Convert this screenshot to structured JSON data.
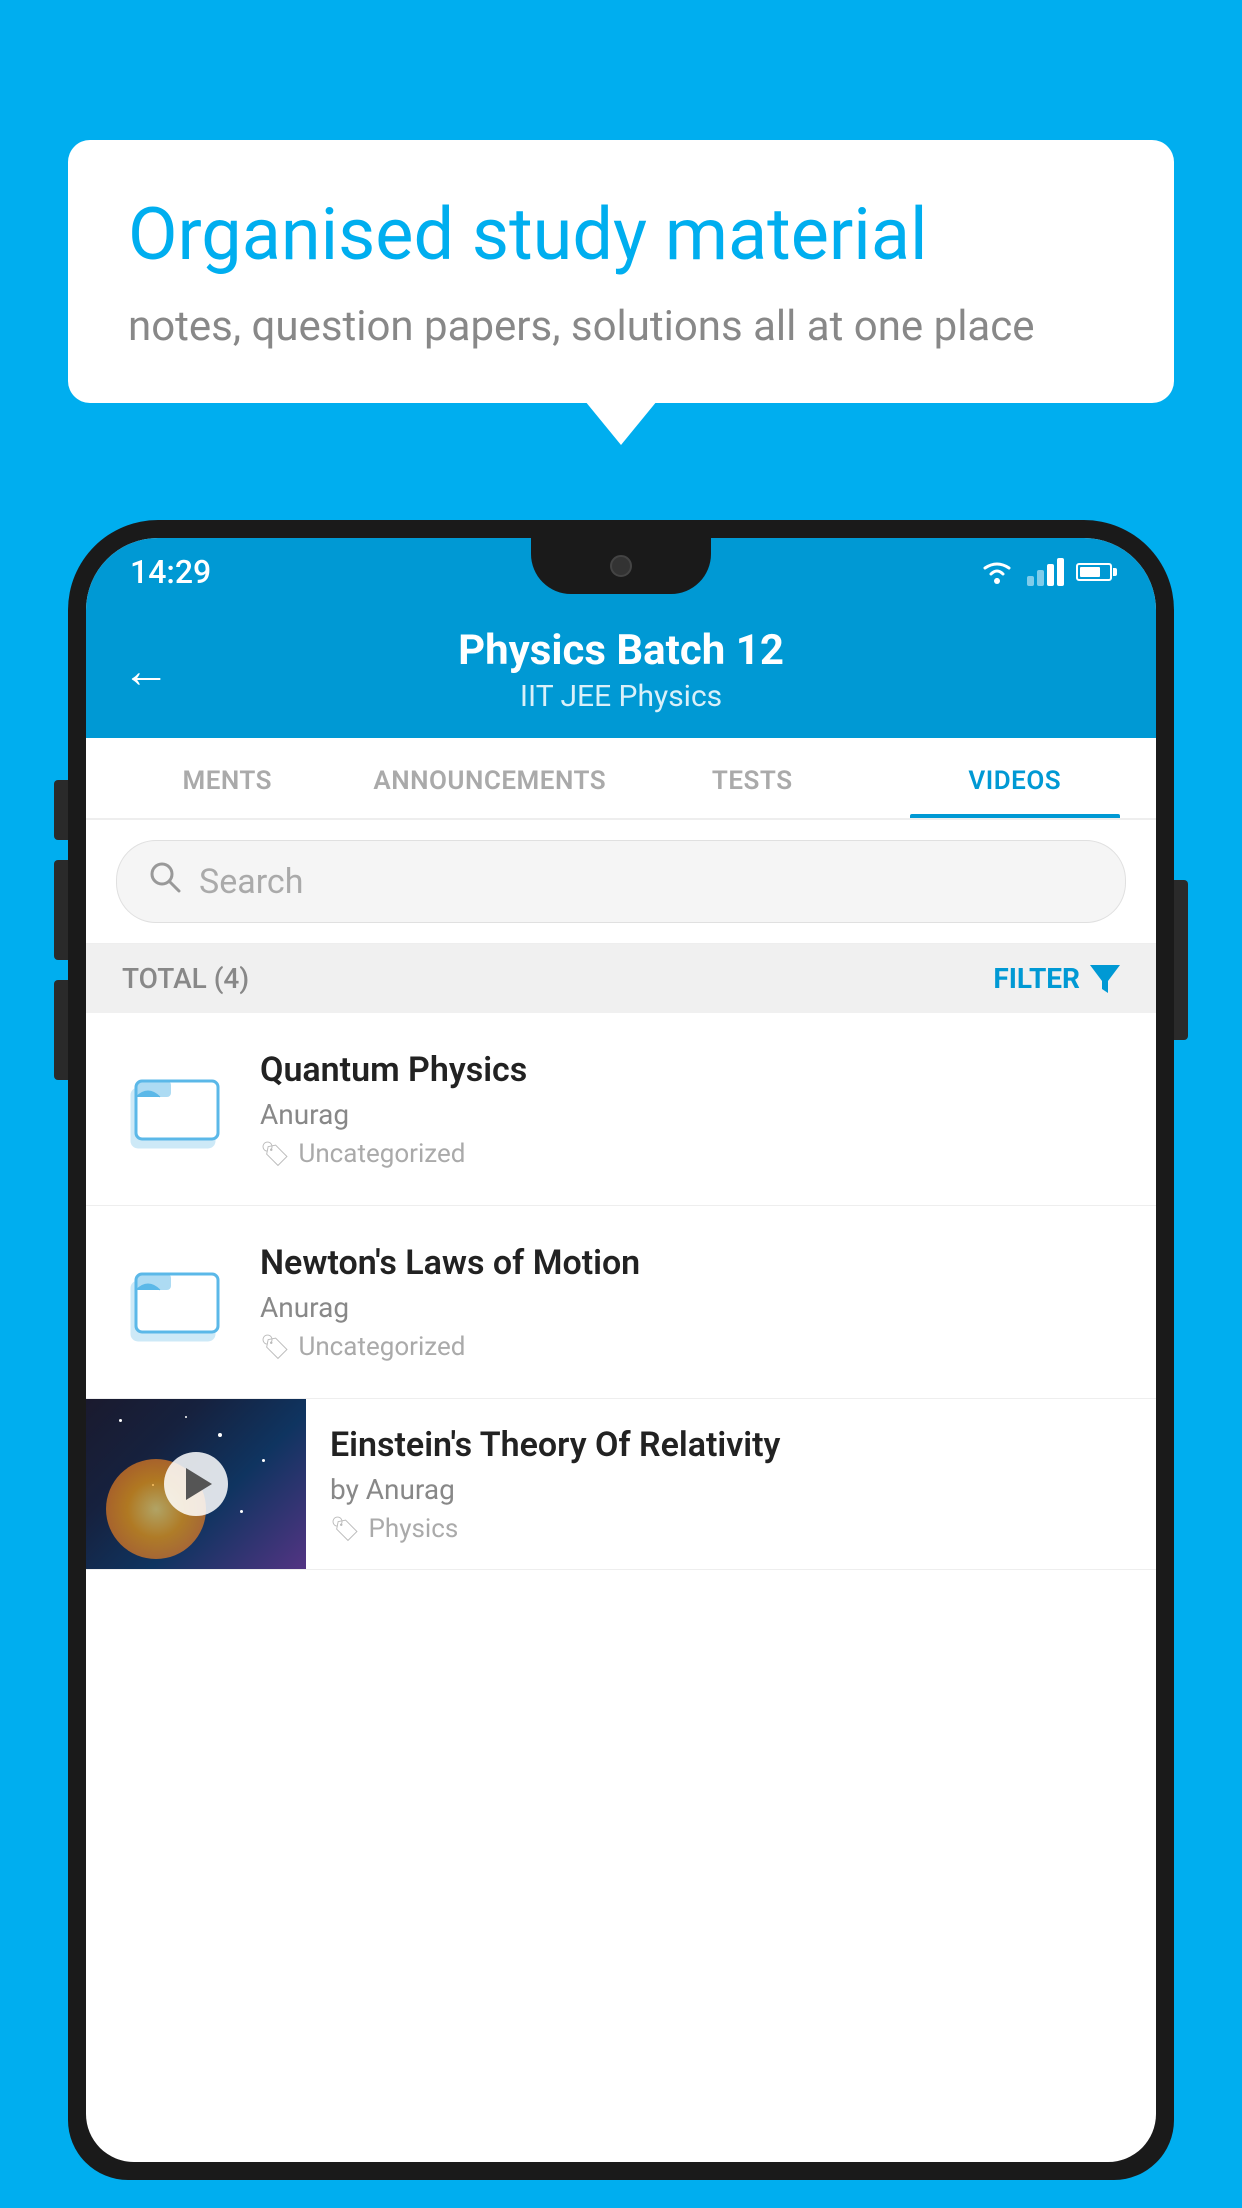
{
  "background_color": "#00AEEF",
  "bubble": {
    "title": "Organised study material",
    "subtitle": "notes, question papers, solutions all at one place"
  },
  "status_bar": {
    "time": "14:29"
  },
  "header": {
    "back_label": "←",
    "title": "Physics Batch 12",
    "subtitle": "IIT JEE   Physics"
  },
  "tabs": [
    {
      "label": "MENTS",
      "active": false
    },
    {
      "label": "ANNOUNCEMENTS",
      "active": false
    },
    {
      "label": "TESTS",
      "active": false
    },
    {
      "label": "VIDEOS",
      "active": true
    }
  ],
  "search": {
    "placeholder": "Search"
  },
  "filter_bar": {
    "total_label": "TOTAL (4)",
    "filter_label": "FILTER"
  },
  "videos": [
    {
      "type": "folder",
      "title": "Quantum Physics",
      "author": "Anurag",
      "tag": "Uncategorized"
    },
    {
      "type": "folder",
      "title": "Newton's Laws of Motion",
      "author": "Anurag",
      "tag": "Uncategorized"
    },
    {
      "type": "thumbnail",
      "title": "Einstein's Theory Of Relativity",
      "author": "by Anurag",
      "tag": "Physics"
    }
  ]
}
